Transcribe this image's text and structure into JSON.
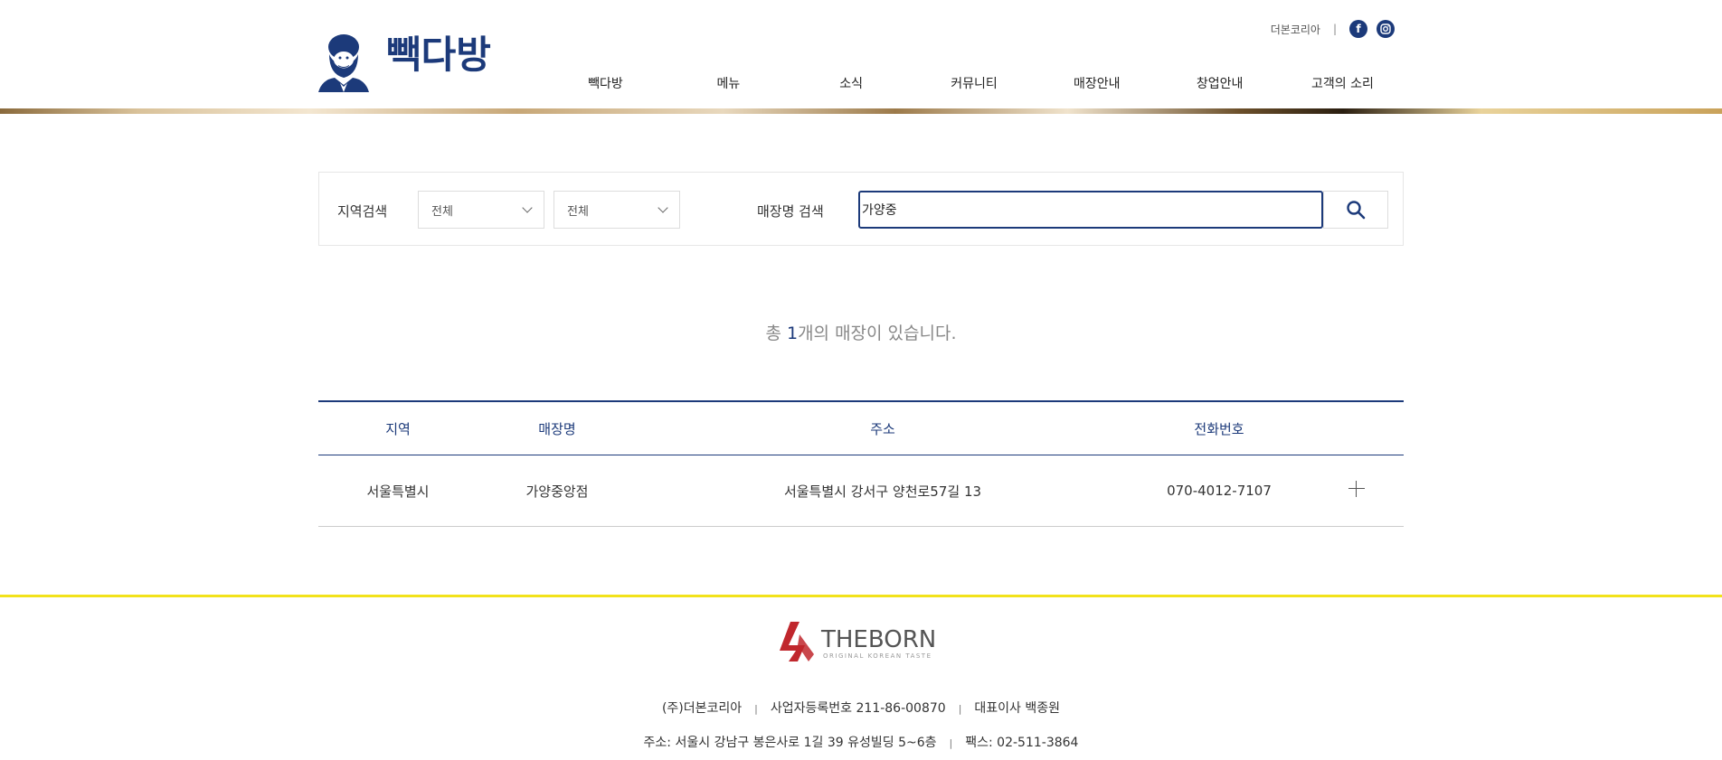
{
  "header": {
    "brand": "빽다방",
    "util_link": "더본코리아",
    "social": [
      {
        "icon": "facebook-icon",
        "glyph": "f"
      },
      {
        "icon": "instagram-icon",
        "glyph": ""
      }
    ],
    "nav": [
      "빽다방",
      "메뉴",
      "소식",
      "커뮤니티",
      "매장안내",
      "창업안내",
      "고객의 소리"
    ]
  },
  "search": {
    "region_label": "지역검색",
    "region1_value": "전체",
    "region2_value": "전체",
    "store_label": "매장명 검색",
    "store_value": "가양중"
  },
  "result": {
    "prefix": "총 ",
    "count": "1",
    "suffix": "개의 매장이 있습니다."
  },
  "table": {
    "headers": [
      "지역",
      "매장명",
      "주소",
      "전화번호"
    ],
    "rows": [
      {
        "region": "서울특별시",
        "name": "가양중앙점",
        "address": "서울특별시 강서구 양천로57길 13",
        "phone": "070-4012-7107"
      }
    ]
  },
  "footer": {
    "logo_text": "THEBORN",
    "logo_sub": "ORIGINAL KOREAN TASTE",
    "company": "(주)더본코리아",
    "biz_no": "사업자등록번호 211-86-00870",
    "ceo": "대표이사 백종원",
    "address": "주소: 서울시 강남구 봉은사로 1길 39 유성빌딩 5~6층",
    "fax": "팩스: 02-511-3864",
    "separator": "|"
  },
  "colors": {
    "brand_navy": "#1c3a7a",
    "accent_yellow": "#f2e21a",
    "theborn_red": "#c0272d"
  }
}
